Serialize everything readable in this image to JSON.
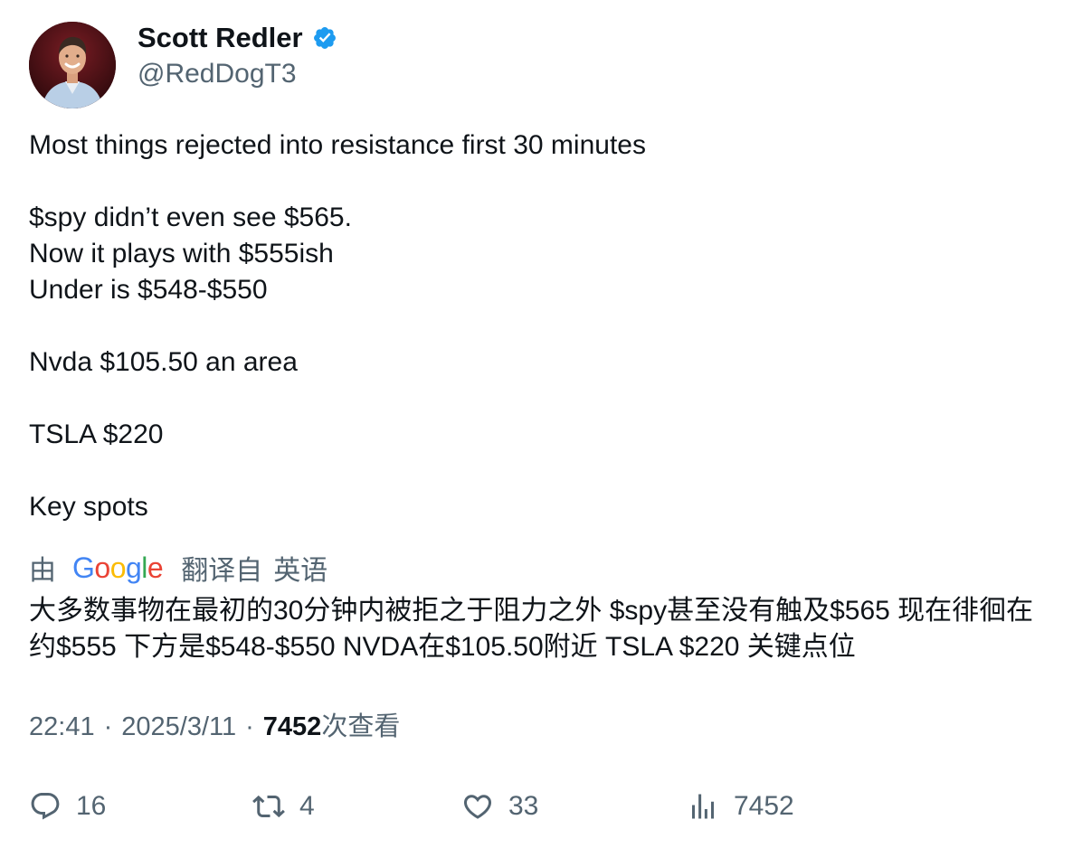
{
  "author": {
    "display_name": "Scott Redler",
    "handle": "@RedDogT3",
    "verified": true,
    "avatar": "profile-photo"
  },
  "tweet": {
    "text": "Most things rejected into resistance first 30 minutes\n\n$spy didn’t even see $565.\nNow it plays with $555ish\nUnder is $548-$550\n\nNvda $105.50 an area\n\nTSLA $220\n\nKey spots"
  },
  "translation": {
    "by_label": "由",
    "provider": "Google",
    "translated_from_label": "翻译自",
    "source_language": "英语",
    "text": "大多数事物在最初的30分钟内被拒之于阻力之外 $spy甚至没有触及$565 现在徘徊在约$555 下方是$548-$550 NVDA在$105.50附近 TSLA $220 关键点位"
  },
  "meta": {
    "time": "22:41",
    "separator": "·",
    "date": "2025/3/11",
    "views_count": "7452",
    "views_label": "次查看"
  },
  "actions": {
    "replies": "16",
    "retweets": "4",
    "likes": "33",
    "views": "7452"
  },
  "colors": {
    "text_primary": "#0f1419",
    "text_secondary": "#536471",
    "verified_blue": "#1d9bf0",
    "google_blue": "#4285f4",
    "google_red": "#ea4335",
    "google_yellow": "#fbbc05",
    "google_green": "#34a853"
  }
}
